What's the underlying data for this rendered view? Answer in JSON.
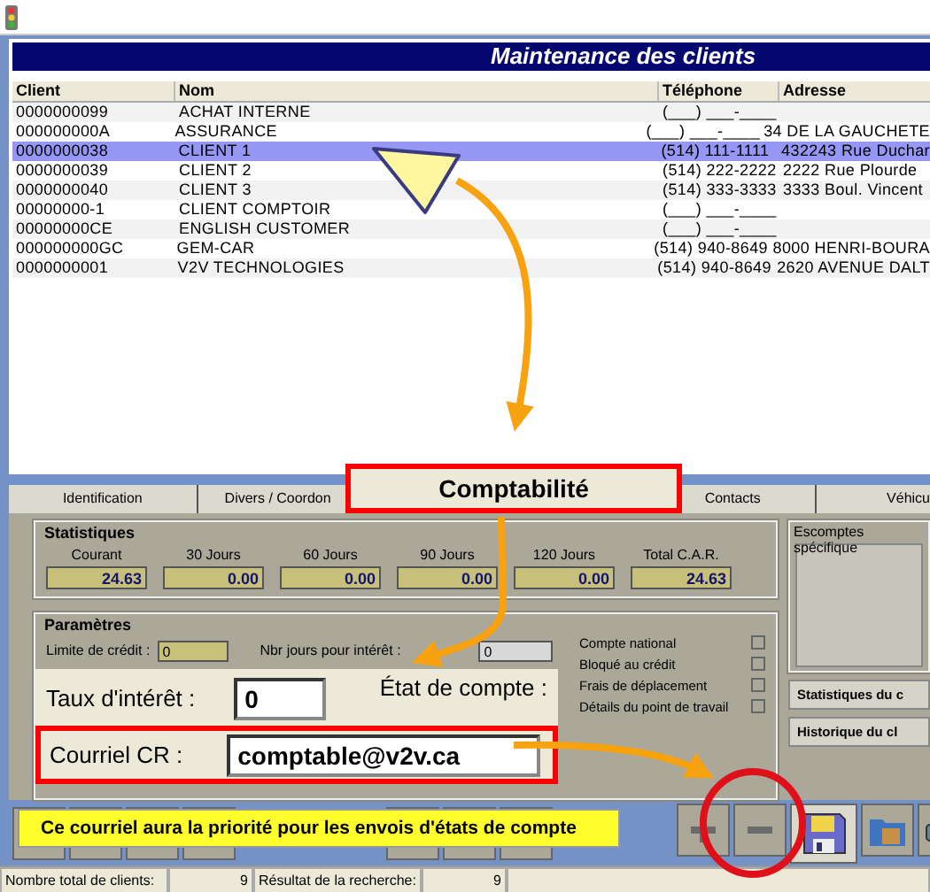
{
  "window": {
    "title": "Maintenance des clients"
  },
  "table": {
    "columns": [
      "Client",
      "Nom",
      "Téléphone",
      "Adresse"
    ],
    "rows": [
      {
        "cells": [
          "0000000099",
          "ACHAT INTERNE",
          "(___) ___-____",
          ""
        ],
        "selected": false
      },
      {
        "cells": [
          "000000000A",
          "ASSURANCE",
          "(___) ___-____",
          "34 DE LA GAUCHETE"
        ],
        "selected": false
      },
      {
        "cells": [
          "0000000038",
          "CLIENT 1",
          "(514) 111-1111",
          "432243 Rue Duchar"
        ],
        "selected": true
      },
      {
        "cells": [
          "0000000039",
          "CLIENT 2",
          "(514) 222-2222",
          "2222 Rue Plourde"
        ],
        "selected": false
      },
      {
        "cells": [
          "0000000040",
          "CLIENT 3",
          "(514) 333-3333",
          "3333 Boul. Vincent"
        ],
        "selected": false
      },
      {
        "cells": [
          "00000000-1",
          "CLIENT COMPTOIR",
          "(___) ___-____",
          ""
        ],
        "selected": false
      },
      {
        "cells": [
          "00000000CE",
          "ENGLISH CUSTOMER",
          "(___) ___-____",
          ""
        ],
        "selected": false
      },
      {
        "cells": [
          "000000000GC",
          "GEM-CAR",
          "(514) 940-8649",
          "8000 HENRI-BOURA"
        ],
        "selected": false
      },
      {
        "cells": [
          "0000000001",
          "V2V TECHNOLOGIES",
          "(514) 940-8649",
          "2620 AVENUE DALT"
        ],
        "selected": false
      }
    ]
  },
  "tabs": [
    "Identification",
    "Divers / Coordon",
    "Contacts",
    "Véhicu"
  ],
  "statistics": {
    "title": "Statistiques",
    "items": [
      {
        "label": "Courant",
        "value": "24.63"
      },
      {
        "label": "30 Jours",
        "value": "0.00"
      },
      {
        "label": "60 Jours",
        "value": "0.00"
      },
      {
        "label": "90 Jours",
        "value": "0.00"
      },
      {
        "label": "120 Jours",
        "value": "0.00"
      },
      {
        "label": "Total C.A.R.",
        "value": "24.63"
      }
    ]
  },
  "parameters": {
    "title": "Paramètres",
    "credit_limit_label": "Limite de crédit :",
    "credit_limit_value": "0",
    "interest_days_label": "Nbr jours pour intérêt :",
    "interest_days_value": "0",
    "checkboxes": [
      {
        "label": "Compte national",
        "checked": false
      },
      {
        "label": "Bloqué au crédit",
        "checked": false
      },
      {
        "label": "Frais de déplacement",
        "checked": false
      },
      {
        "label": "Détails du point de travail",
        "checked": false
      }
    ]
  },
  "discounts": {
    "title": "Escomptes spécifique"
  },
  "side_buttons": [
    "Statistiques du c",
    "Historique du cl"
  ],
  "status_bar": [
    {
      "label": "Nombre total de clients:",
      "value": "9"
    },
    {
      "label": "Résultat de la recherche:",
      "value": "9"
    }
  ],
  "tab_callout": {
    "label": "Comptabilité"
  },
  "zoom_callout": {
    "rate_label": "Taux d'intérêt :",
    "rate_value": "0",
    "statement_label": "État de compte :",
    "email_label": "Courriel CR :",
    "email_value": "comptable@v2v.ca"
  },
  "note": "Ce courriel aura la priorité pour les envois d'états de compte"
}
